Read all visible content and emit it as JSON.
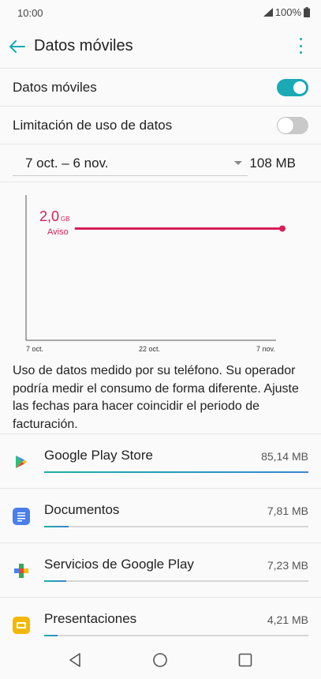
{
  "status_bar": {
    "time": "10:00",
    "battery": "100%"
  },
  "header": {
    "title": "Datos móviles"
  },
  "settings": {
    "mobile_data_label": "Datos móviles",
    "mobile_data_enabled": true,
    "data_limit_label": "Limitación de uso de datos",
    "data_limit_enabled": false
  },
  "period": {
    "range": "7 oct. – 6 nov.",
    "total": "108 MB"
  },
  "chart_data": {
    "type": "line",
    "x_ticks": [
      "7 oct.",
      "22 oct.",
      "7 nov."
    ],
    "limit_line": {
      "value": 2.0,
      "value_label": "2,0",
      "unit": "GB",
      "label": "Aviso"
    },
    "series": [],
    "ylim": [
      0,
      2.6
    ],
    "colors": {
      "limit": "#d61f57",
      "axis": "#555555"
    }
  },
  "description": "Uso de datos medido por su teléfono. Su operador podría medir el consumo de forma diferente. Ajuste las fechas para hacer coincidir el periodo de facturación.",
  "apps": [
    {
      "name": "Google Play Store",
      "size": "85,14 MB",
      "fraction": 1.0,
      "icon": "play-store-icon"
    },
    {
      "name": "Documentos",
      "size": "7,81 MB",
      "fraction": 0.092,
      "icon": "docs-icon"
    },
    {
      "name": "Servicios de Google Play",
      "size": "7,23 MB",
      "fraction": 0.085,
      "icon": "play-services-icon"
    },
    {
      "name": "Presentaciones",
      "size": "4,21 MB",
      "fraction": 0.05,
      "icon": "slides-icon"
    }
  ],
  "colors": {
    "accent": "#1aa9b5",
    "warning": "#d61f57"
  }
}
